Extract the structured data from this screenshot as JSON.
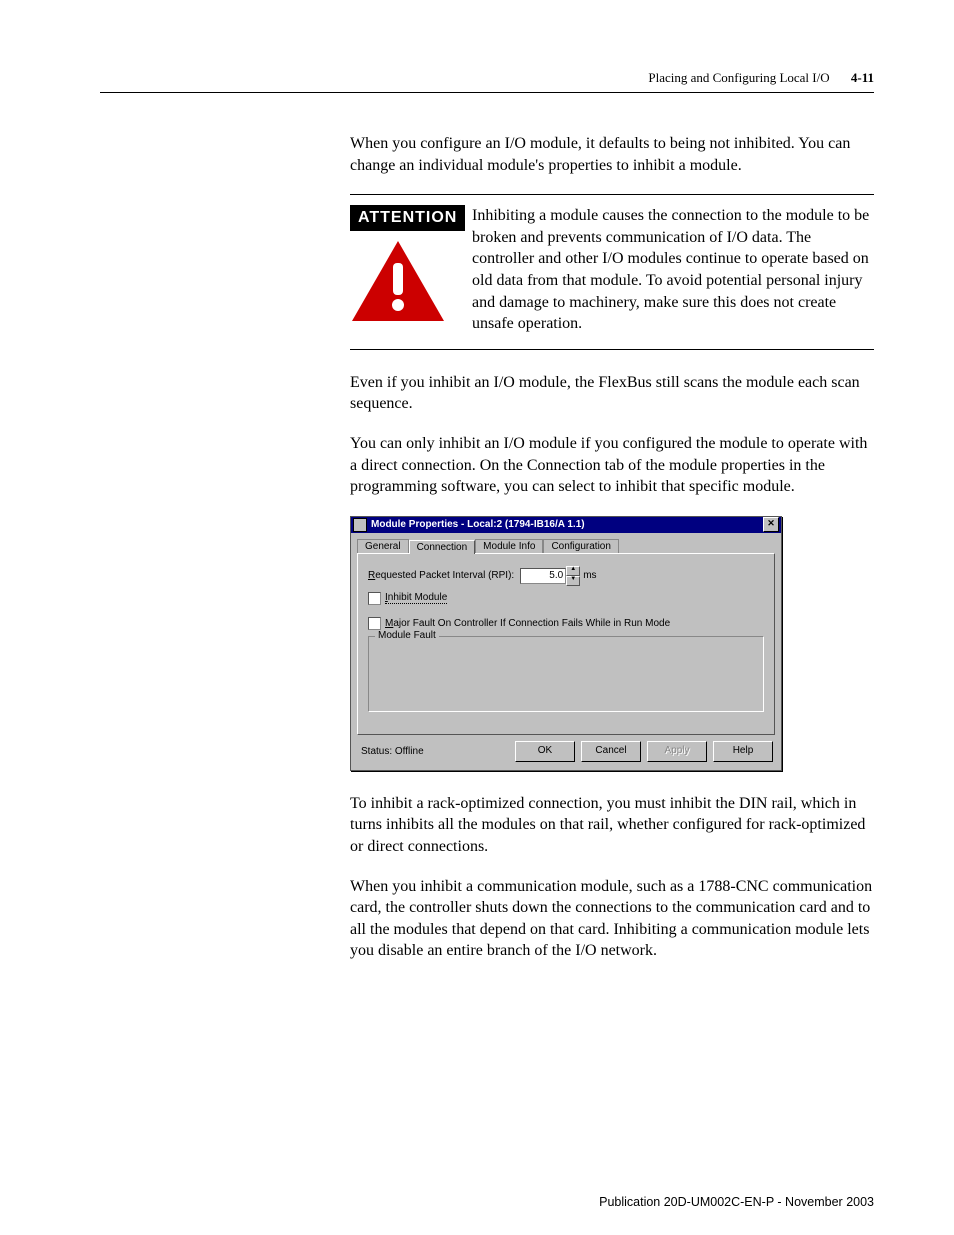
{
  "header": {
    "section": "Placing and Configuring Local I/O",
    "page": "4-11"
  },
  "p1": "When you configure an I/O module, it defaults to being not inhibited. You can change an individual module's properties to inhibit a module.",
  "attention": {
    "label": "ATTENTION",
    "text": "Inhibiting a module causes the connection to the module to be broken and prevents communication of I/O data. The controller and other I/O modules continue to operate based on old data from that module. To avoid potential personal injury and damage to machinery, make sure this does not create unsafe operation."
  },
  "p2": "Even if you inhibit an I/O module, the FlexBus still scans the module each scan sequence.",
  "p3": "You can only inhibit an I/O module if you configured the module to operate with a direct connection. On the Connection tab of the module properties in the programming software, you can select to inhibit that specific module.",
  "dialog": {
    "title": "Module Properties - Local:2 (1794-IB16/A 1.1)",
    "tabs": {
      "general": "General",
      "connection": "Connection",
      "moduleinfo": "Module Info",
      "configuration": "Configuration"
    },
    "rpi_label_pre": "R",
    "rpi_label_mid": "equested Packet Interval (RPI):",
    "rpi_value": "5.0",
    "rpi_unit": "ms",
    "inhibit_pre": "I",
    "inhibit_rest": "nhibit Module",
    "major_pre": "M",
    "major_rest": "ajor Fault On Controller If Connection Fails While in Run Mode",
    "group_legend": "Module Fault",
    "status": "Status: Offline",
    "ok": "OK",
    "cancel": "Cancel",
    "apply": "Apply",
    "help": "Help"
  },
  "p4": "To inhibit a rack-optimized connection, you must inhibit the DIN rail, which in turns inhibits all the modules on that rail, whether configured for rack-optimized or direct connections.",
  "p5": "When you inhibit a communication module, such as a 1788-CNC communication card, the controller shuts down the connections to the communication card and to all the modules that depend on that card. Inhibiting a communication module lets you disable an entire branch of the I/O network.",
  "footer": "Publication 20D-UM002C-EN-P - November 2003"
}
